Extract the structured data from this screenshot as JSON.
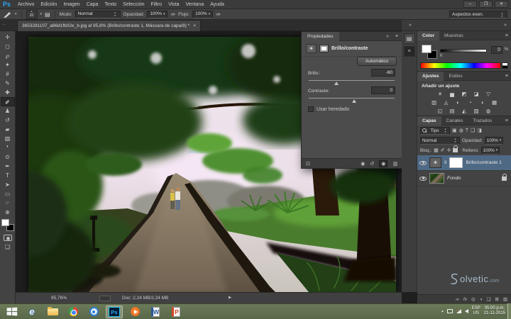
{
  "titlebar": {
    "logo": "Ps",
    "menus": [
      "Archivo",
      "Edición",
      "Imagen",
      "Capa",
      "Texto",
      "Selección",
      "Filtro",
      "Vista",
      "Ventana",
      "Ayuda"
    ],
    "minimize": "–",
    "restore": "❐",
    "close": "✕"
  },
  "optionsbar": {
    "brush_dot": "•",
    "brush_size": "20",
    "mode_label": "Modo:",
    "mode_value": "Normal",
    "opacity_label": "Opacidad:",
    "opacity_value": "100%",
    "flow_label": "Flujo:",
    "flow_value": "100%",
    "workspace": "Aspectos esen."
  },
  "tabbar": {
    "title": "3653281107_a86d1fb02e_b.jpg al 95,8% (Brillo/contraste 1, Máscara de capa/8) *",
    "close": "×"
  },
  "toolbar": {
    "tools": [
      {
        "name": "move",
        "glyph": "✛"
      },
      {
        "name": "marquee",
        "glyph": "◻"
      },
      {
        "name": "lasso",
        "glyph": "℘"
      },
      {
        "name": "quick-selection",
        "glyph": "✦"
      },
      {
        "name": "crop",
        "glyph": "#"
      },
      {
        "name": "eyedropper",
        "glyph": "✎"
      },
      {
        "name": "healing-brush",
        "glyph": "✚"
      },
      {
        "name": "brush",
        "glyph": "✐"
      },
      {
        "name": "clone-stamp",
        "glyph": "♟"
      },
      {
        "name": "history-brush",
        "glyph": "↺"
      },
      {
        "name": "eraser",
        "glyph": "▰"
      },
      {
        "name": "gradient",
        "glyph": "▨"
      },
      {
        "name": "blur",
        "glyph": "❜"
      },
      {
        "name": "dodge",
        "glyph": "⊙"
      },
      {
        "name": "pen",
        "glyph": "✒"
      },
      {
        "name": "type",
        "glyph": "T"
      },
      {
        "name": "path-selection",
        "glyph": "➤"
      },
      {
        "name": "shape",
        "glyph": "▭"
      },
      {
        "name": "hand",
        "glyph": "☞"
      },
      {
        "name": "zoom",
        "glyph": "⊕"
      }
    ],
    "screen_mode_glyph": "❏"
  },
  "properties": {
    "tab": "Propiedades",
    "adjustment_icon": "☀",
    "title": "Brillo/contraste",
    "auto_button": "Automático",
    "brightness_label": "Brillo:",
    "brightness_value": "-60",
    "contrast_label": "Contraste:",
    "contrast_value": "0",
    "legacy_label": "Usar heredado",
    "footer_icons": [
      "⊡",
      "◉",
      "↺",
      "◉",
      "▥"
    ]
  },
  "color_panel": {
    "tab_color": "Color",
    "tab_swatches": "Muestras",
    "k_label": "K",
    "value": "0",
    "unit": "%"
  },
  "adjustments": {
    "tab_adjustments": "Ajustes",
    "tab_styles": "Estilos",
    "heading": "Añadir un ajuste",
    "icons": [
      "☀",
      "▅",
      "◩",
      "◪",
      "▽",
      "▥",
      "◬",
      "◐",
      "◔",
      "◖",
      "▦",
      "◱",
      "▤",
      "◭",
      "▧",
      "◍"
    ]
  },
  "layers": {
    "tab_layers": "Capas",
    "tab_channels": "Canales",
    "tab_paths": "Trazados",
    "filter_label": "Tipo",
    "filter_icons": [
      "▣",
      "◍",
      "T",
      "❑",
      "◨"
    ],
    "blend_mode": "Normal",
    "opacity_label": "Opacidad:",
    "opacity_value": "100%",
    "lock_label": "Bloq.:",
    "lock_icons": [
      "▦",
      "✐",
      "✛"
    ],
    "fill_label": "Relleno:",
    "fill_value": "100%",
    "layer1_name": "Brillo/contraste 1",
    "layer1_icon": "☀",
    "chain": "8",
    "layer2_name": "Fondo",
    "footer_icons": [
      "∞",
      "fx",
      "◎",
      "◑",
      "❑",
      "⊞",
      "▥"
    ]
  },
  "statusbar": {
    "zoom": "95,76%",
    "doc": "Doc: 2,24 MB/2,24 MB",
    "arrow": "▶"
  },
  "taskbar": {
    "ie": "e",
    "ps": "Ps",
    "word": "W",
    "powerpoint": "P",
    "tray_arrow": "▴",
    "lang_top": "ESP",
    "lang_bottom": "US",
    "time": "05:00 p.m.",
    "date": "21-11-2015"
  },
  "watermark": {
    "s": "S",
    "name": "olvetic",
    "tld": ".com"
  },
  "glyphs": {
    "menu": "≡",
    "caret": "▾",
    "dots": "‥",
    "double_left": "«",
    "double_right": "»",
    "airbrush": "✑",
    "panel_toggle": "▤",
    "strip_icon1": "▤",
    "strip_icon2": "≡"
  },
  "canvas": {
    "alt": "Foto de un parque: gran árbol frondoso sobre un sendero de cemento mojado con bordes de piedra, dos personas caminando, césped verde y fondo brumoso blanco-rosado"
  }
}
